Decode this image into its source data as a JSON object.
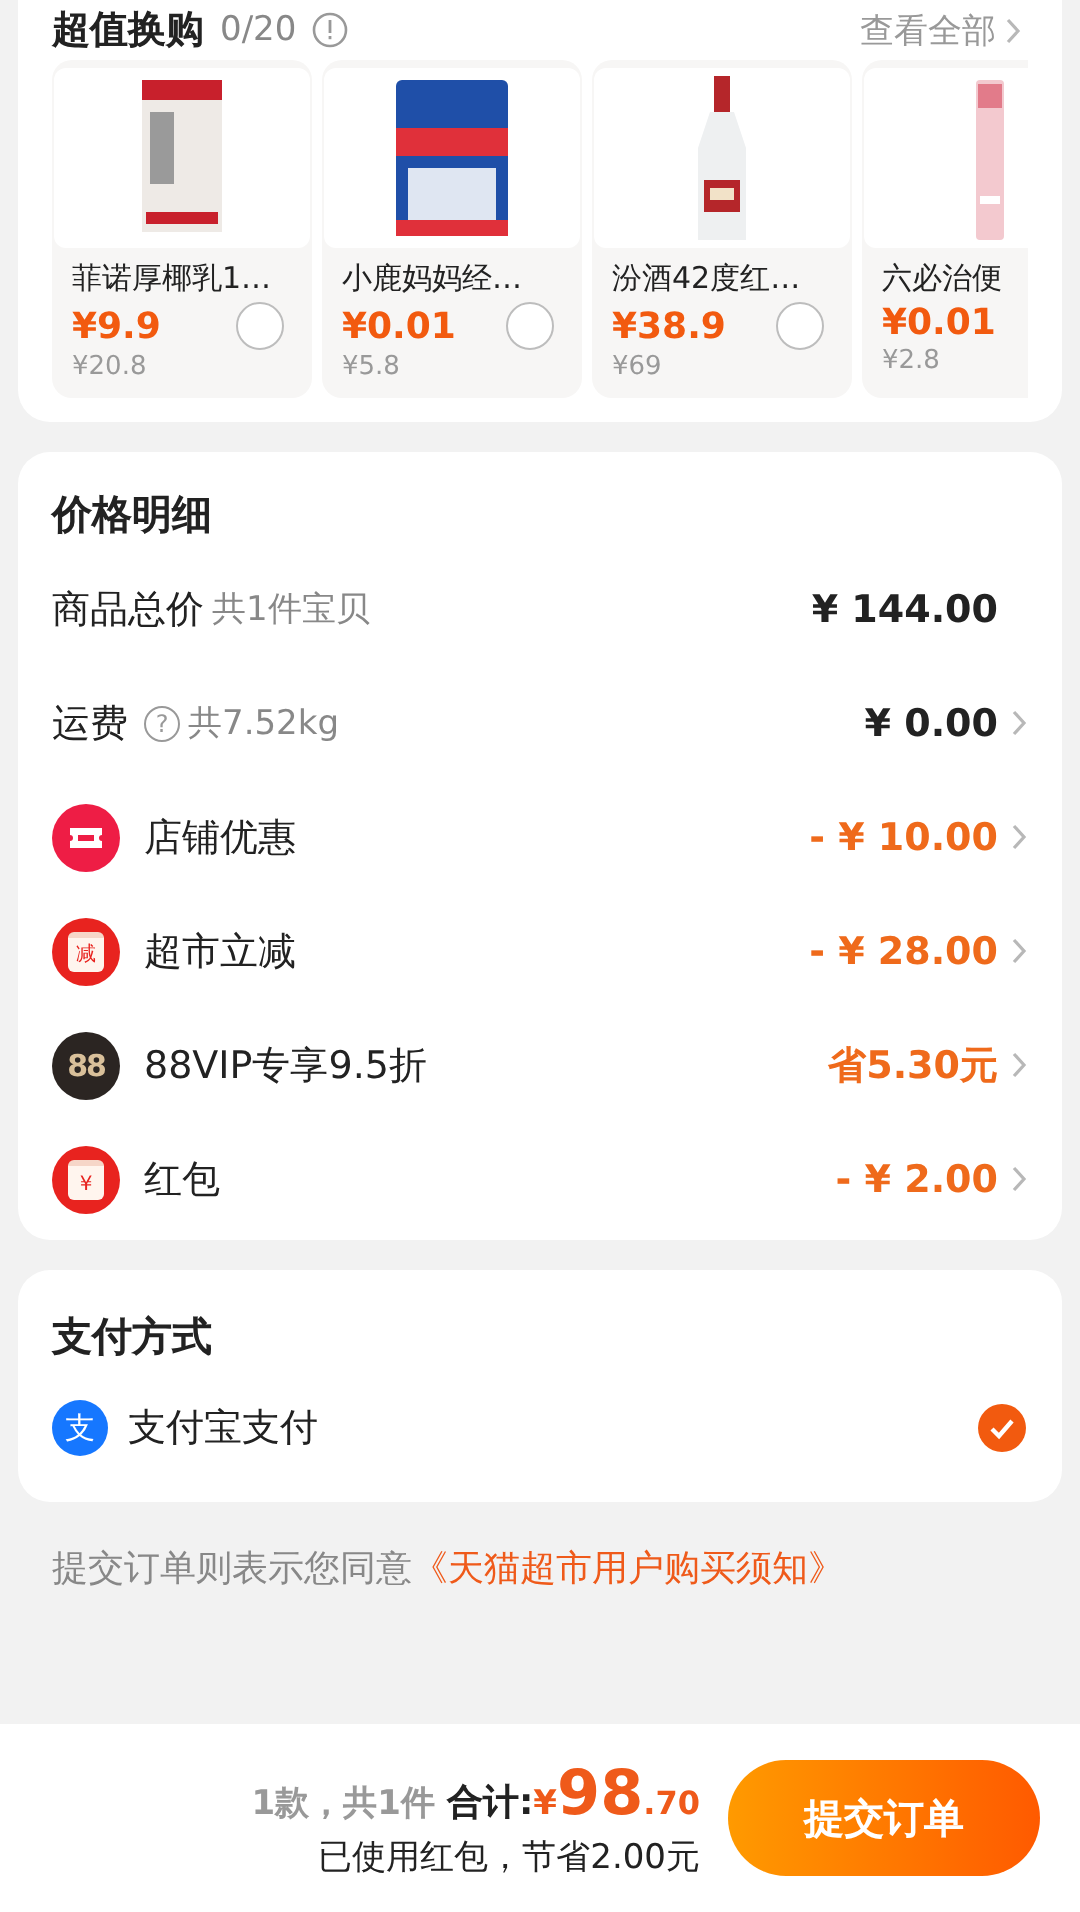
{
  "exchange": {
    "title": "超值换购",
    "count": "0/20",
    "view_all": "查看全部",
    "products": [
      {
        "name": "菲诺厚椰乳1…",
        "price": "¥9.9",
        "original_price": "¥20.8",
        "selected": false
      },
      {
        "name": "小鹿妈妈经…",
        "price": "¥0.01",
        "original_price": "¥5.8",
        "selected": false
      },
      {
        "name": "汾酒42度红…",
        "price": "¥38.9",
        "original_price": "¥69",
        "selected": false
      },
      {
        "name": "六必治便",
        "price": "¥0.01",
        "original_price": "¥2.8"
      }
    ]
  },
  "price_detail": {
    "title": "价格明细",
    "rows": [
      {
        "kind": "plain",
        "label": "商品总价",
        "note": "共1件宝贝",
        "amount": "¥ 144.00",
        "highlight": false,
        "arrow": false
      },
      {
        "kind": "shipping",
        "label": "运费",
        "help": "?",
        "note": "共7.52kg",
        "amount": "¥ 0.00",
        "highlight": false,
        "arrow": true
      },
      {
        "kind": "ticket",
        "label": "店铺优惠",
        "amount": "- ¥ 10.00",
        "highlight": true,
        "arrow": true
      },
      {
        "kind": "envelope",
        "icon_text": "减",
        "label": "超市立减",
        "amount": "- ¥ 28.00",
        "highlight": true,
        "arrow": true
      },
      {
        "kind": "vip",
        "icon_text": "88",
        "label": "88VIP专享9.5折",
        "amount": "省5.30元",
        "highlight": true,
        "arrow": true
      },
      {
        "kind": "envelope",
        "icon_text": "¥",
        "label": "红包",
        "amount": "- ¥ 2.00",
        "highlight": true,
        "arrow": true
      }
    ]
  },
  "payment": {
    "title": "支付方式",
    "methods": [
      {
        "icon_text": "支",
        "label": "支付宝支付",
        "selected": true
      }
    ]
  },
  "agreement": {
    "text": "提交订单则表示您同意",
    "link": "《天猫超市用户购买须知》"
  },
  "footer": {
    "count": "1款，共1件",
    "total_label": "合计:",
    "currency": "¥",
    "total_int": "98",
    "total_dec": ".70",
    "savings": "已使用红包，节省2.00元",
    "submit": "提交订单"
  }
}
